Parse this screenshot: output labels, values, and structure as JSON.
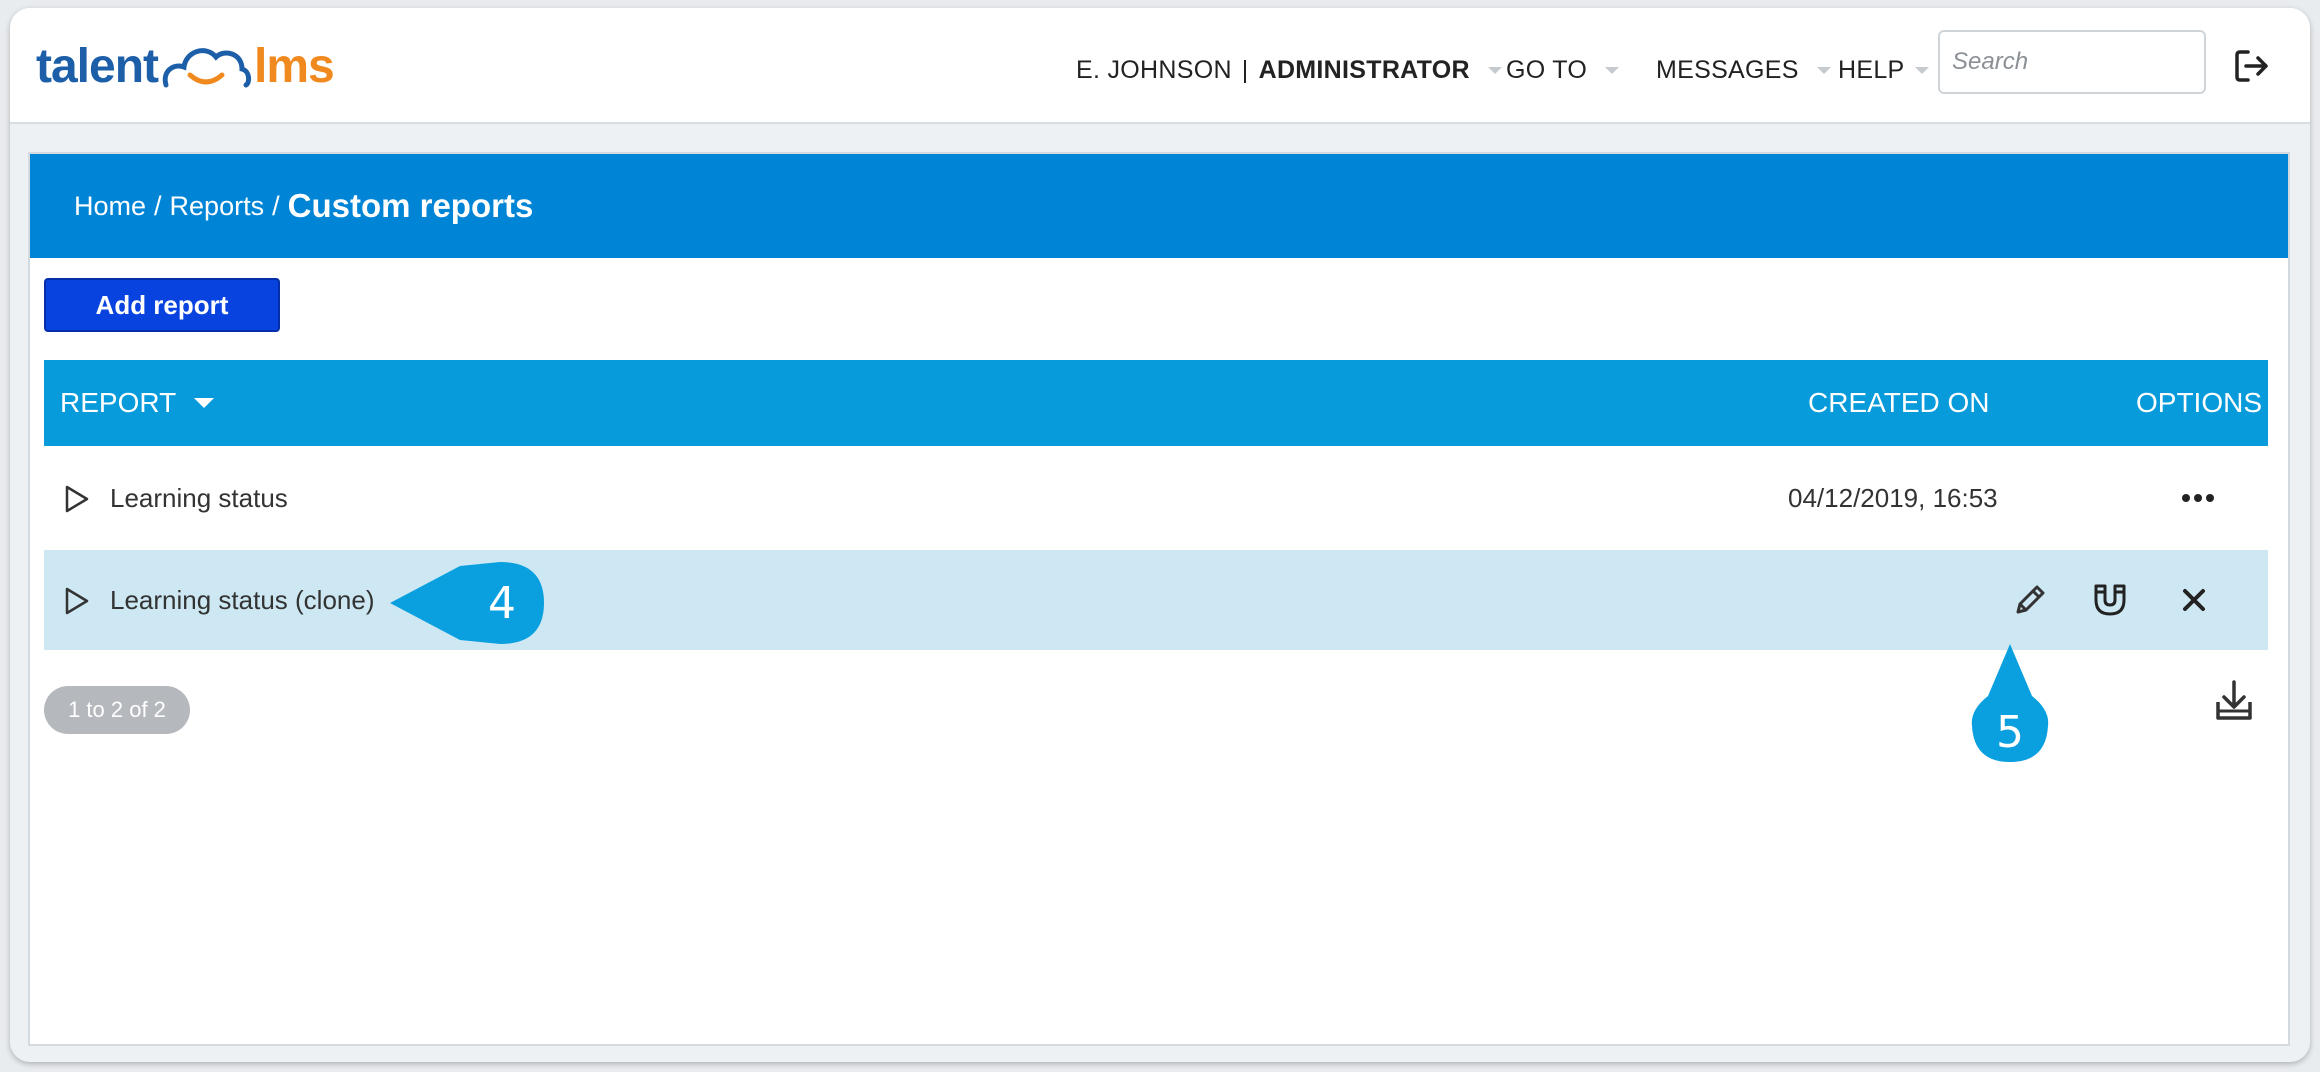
{
  "app": {
    "logo_left": "talent",
    "logo_right": "lms",
    "brand_blue": "#1c5fa8",
    "brand_orange": "#f08a1f"
  },
  "header": {
    "user_name": "E. JOHNSON",
    "user_sep": "|",
    "user_role": "ADMINISTRATOR",
    "goto_label": "GO TO",
    "messages_label": "MESSAGES",
    "help_label": "HELP",
    "search_placeholder": "Search",
    "logout_icon": "logout-icon"
  },
  "breadcrumb": {
    "home": "Home",
    "reports": "Reports",
    "separator": "/",
    "current": "Custom reports"
  },
  "toolbar": {
    "add_label": "Add report"
  },
  "table": {
    "columns": {
      "report": "REPORT",
      "created_on": "CREATED ON",
      "options": "OPTIONS"
    },
    "rows": [
      {
        "name": "Learning status",
        "created_on": "04/12/2019, 16:53"
      },
      {
        "name": "Learning status (clone)",
        "created_on": ""
      }
    ],
    "header_color": "#079bdb",
    "highlight_color": "#cde8f3"
  },
  "annotations": {
    "marker_4": "4",
    "marker_5": "5"
  },
  "footer": {
    "pager_label": "1 to 2 of 2"
  },
  "colors": {
    "banner": "#0084d6",
    "add_button": "#0843e0",
    "marker": "#0aa0e0"
  }
}
